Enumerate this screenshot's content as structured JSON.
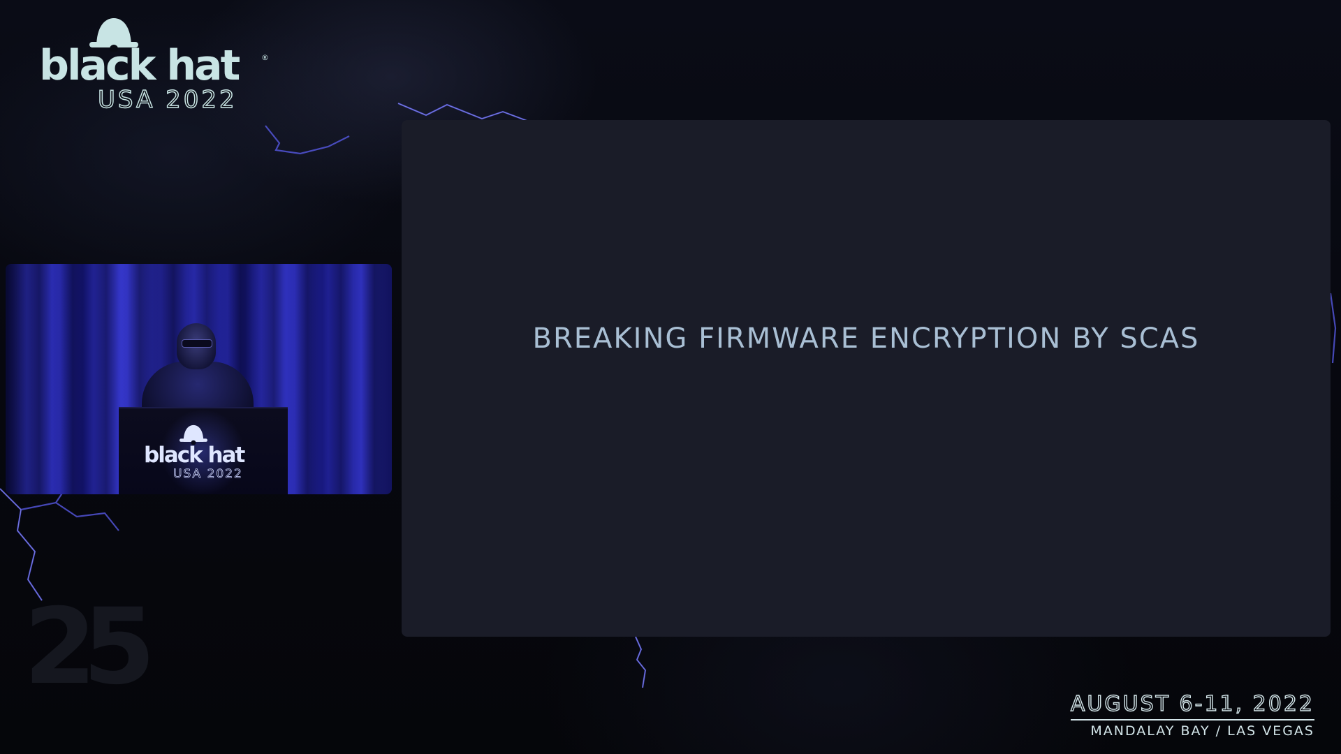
{
  "branding": {
    "logo_word": "black hat",
    "logo_registered": "®",
    "logo_sub": "USA 2022"
  },
  "speaker_video": {
    "podium_word": "black hat",
    "podium_sub": "USA 2022"
  },
  "slide": {
    "title": "BREAKING FIRMWARE ENCRYPTION BY SCAS"
  },
  "watermark": {
    "text": "25"
  },
  "event": {
    "dates": "AUGUST 6-11, 2022",
    "venue": "MANDALAY BAY / LAS VEGAS"
  },
  "colors": {
    "background": "#06070c",
    "slide_background": "#1a1c28",
    "slide_title": "#a9bfd4",
    "logo": "#c8e4e4",
    "lightning": "#6a6cff"
  }
}
